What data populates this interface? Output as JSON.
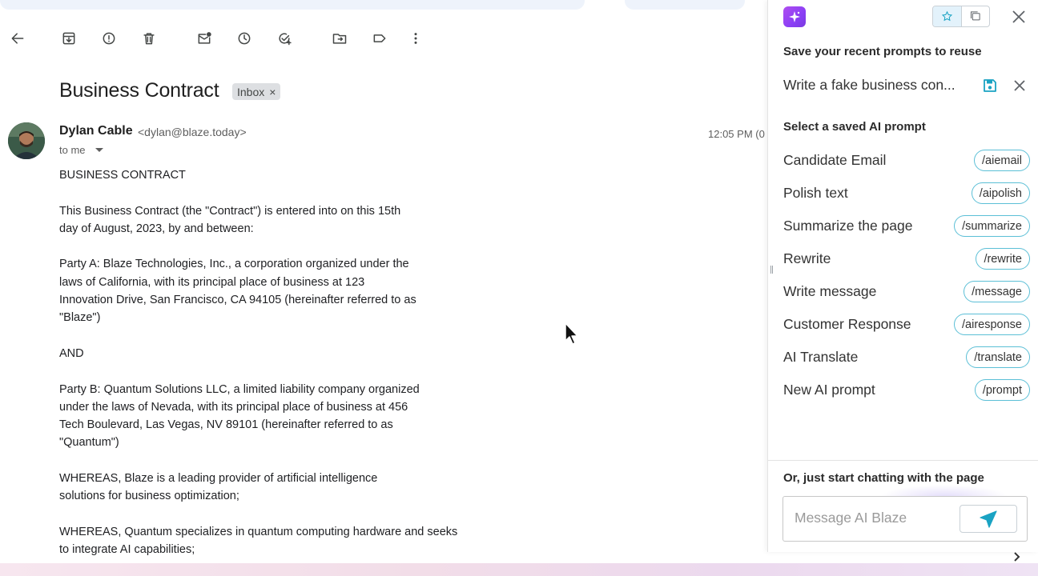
{
  "email": {
    "subject": "Business Contract",
    "label_chip": "Inbox",
    "label_remove": "×",
    "sender_name": "Dylan Cable",
    "sender_email": "<dylan@blaze.today>",
    "recipient": "to me",
    "timestamp": "12:05 PM (0",
    "body": [
      "BUSINESS CONTRACT",
      "This Business Contract (the \"Contract\") is entered into on this 15th\nday of August, 2023, by and between:",
      "Party A: Blaze Technologies, Inc., a corporation organized under the\nlaws of California, with its principal place of business at 123\nInnovation Drive, San Francisco, CA 94105 (hereinafter referred to as\n\"Blaze\")",
      "AND",
      "Party B: Quantum Solutions LLC, a limited liability company organized\nunder the laws of Nevada, with its principal place of business at 456\nTech Boulevard, Las Vegas, NV 89101 (hereinafter referred to as\n\"Quantum\")",
      "WHEREAS, Blaze is a leading provider of artificial intelligence\nsolutions for business optimization;",
      "WHEREAS, Quantum specializes in quantum computing hardware and seeks\nto integrate AI capabilities;"
    ]
  },
  "toolbar": {
    "icons": [
      "back-icon",
      "archive-icon",
      "report-spam-icon",
      "delete-icon",
      "mark-unread-icon",
      "snooze-icon",
      "add-task-icon",
      "move-to-icon",
      "label-icon",
      "more-icon"
    ]
  },
  "panel": {
    "recent_title": "Save your recent prompts to reuse",
    "recent_prompt": "Write a fake business con...",
    "saved_title": "Select a saved AI prompt",
    "prompts": [
      {
        "label": "Candidate Email",
        "shortcut": "/aiemail"
      },
      {
        "label": "Polish text",
        "shortcut": "/aipolish"
      },
      {
        "label": "Summarize the page",
        "shortcut": "/summarize"
      },
      {
        "label": "Rewrite",
        "shortcut": "/rewrite"
      },
      {
        "label": "Write message",
        "shortcut": "/message"
      },
      {
        "label": "Customer Response",
        "shortcut": "/airesponse"
      },
      {
        "label": "AI Translate",
        "shortcut": "/translate"
      },
      {
        "label": "New AI prompt",
        "shortcut": "/prompt"
      }
    ],
    "chat_title": "Or, just start chatting with the page",
    "chat_placeholder": "Message AI Blaze"
  },
  "colors": {
    "accent": "#5bbfd6",
    "send": "#1aa3c3",
    "logo": "#8a3ff5",
    "save_icon": "#1aa3c3"
  }
}
